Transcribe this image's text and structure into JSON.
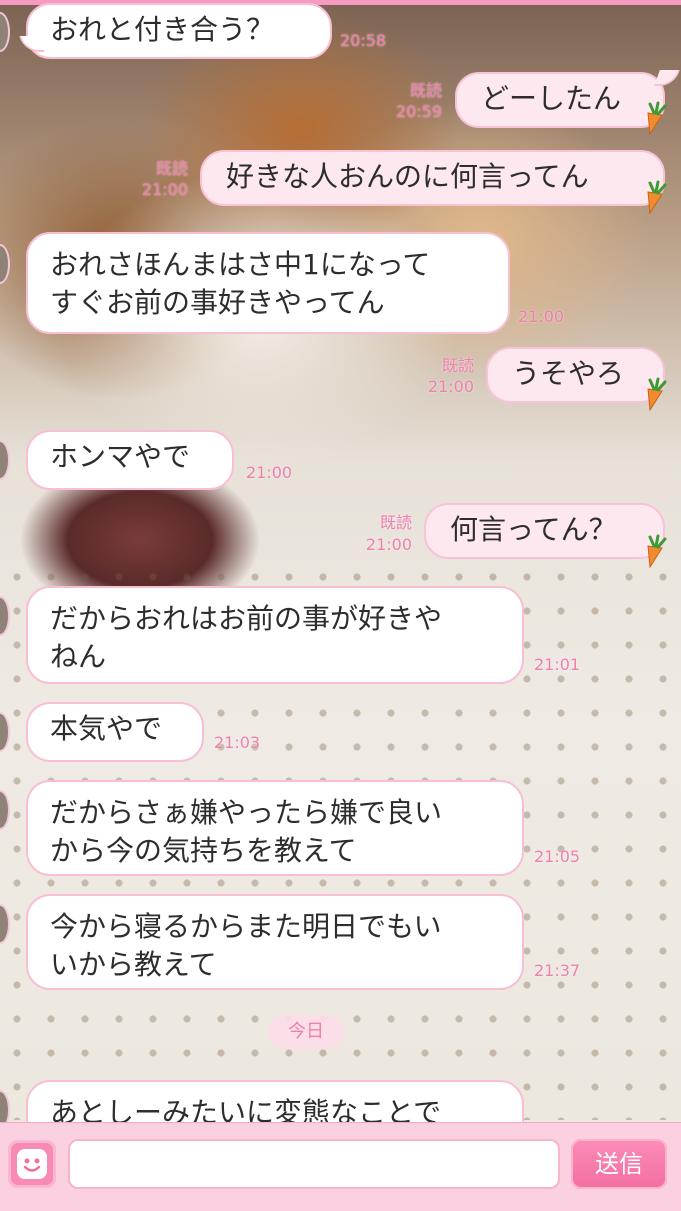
{
  "colors": {
    "accent": "#f07eae",
    "bubble_out": "#fde8ef",
    "bubble_border": "#f8bfd4",
    "footer": "#fbd0e0"
  },
  "messages": [
    {
      "side": "in",
      "text": "おれと付き合う？",
      "time": "20:58"
    },
    {
      "side": "out",
      "text": "どーしたん",
      "read": "既読",
      "time": "20:59",
      "icon": "carrot-icon"
    },
    {
      "side": "out",
      "text": "好きな人おんのに何言ってん",
      "read": "既読",
      "time": "21:00",
      "icon": "carrot-icon"
    },
    {
      "side": "in",
      "lines": [
        "おれさほんまはさ中1になって",
        "すぐお前の事好きやってん"
      ],
      "time": "21:00"
    },
    {
      "side": "out",
      "text": "うそやろ",
      "read": "既読",
      "time": "21:00",
      "icon": "carrot-icon"
    },
    {
      "side": "in",
      "text": "ホンマやで",
      "time": "21:00"
    },
    {
      "side": "out",
      "text": "何言ってん？",
      "read": "既読",
      "time": "21:00",
      "icon": "carrot-icon"
    },
    {
      "side": "in",
      "lines": [
        "だからおれはお前の事が好きや",
        "ねん"
      ],
      "time": "21:01"
    },
    {
      "side": "in",
      "text": "本気やで",
      "time": "21:03"
    },
    {
      "side": "in",
      "lines": [
        "だからさぁ嫌やったら嫌で良い",
        "から今の気持ちを教えて"
      ],
      "time": "21:05"
    },
    {
      "side": "in",
      "lines": [
        "今から寝るからまた明日でもい",
        "いから教えて"
      ],
      "time": "21:37"
    },
    {
      "side": "in",
      "text": "あとしーみたいに変態なことで"
    }
  ],
  "date_divider": "今日",
  "footer": {
    "emoji_icon": "smiley-icon",
    "input_value": "",
    "send_label": "送信"
  }
}
